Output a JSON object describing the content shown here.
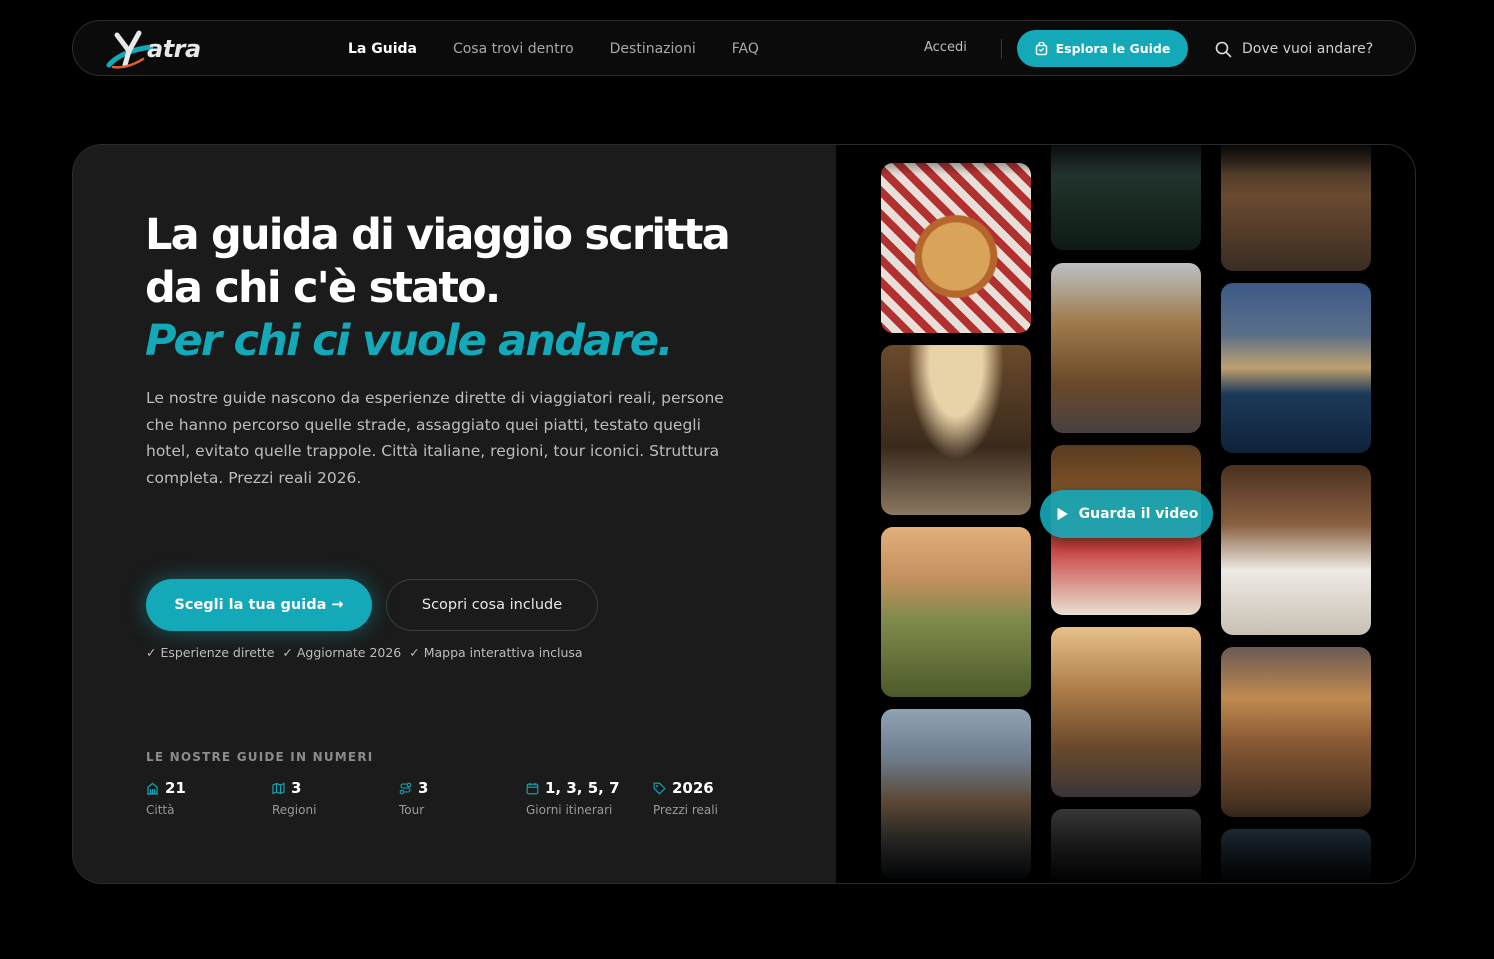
{
  "brand": {
    "logo_text": "atra"
  },
  "nav": {
    "links": [
      "La Guida",
      "Cosa trovi dentro",
      "Destinazioni",
      "FAQ"
    ],
    "login": "Accedi",
    "cta": "Esplora le Guide",
    "search_placeholder": "Dove vuoi andare?"
  },
  "hero": {
    "headline_line1": "La guida di viaggio scritta",
    "headline_line2": "da chi c'è stato.",
    "headline_accent": "Per chi ci vuole andare.",
    "description": "Le nostre guide nascono da esperienze dirette di viaggiatori reali, persone che hanno percorso quelle strade, assaggiato quei piatti, testato quegli hotel, evitato quelle trappole. Città italiane, regioni, tour iconici. Struttura completa. Prezzi reali 2026.",
    "cta_primary": "Scegli la tua guida →",
    "cta_secondary": "Scopri cosa include",
    "checks": [
      "✓ Esperienze dirette",
      "✓ Aggiornate 2026",
      "✓ Mappa interattiva inclusa"
    ],
    "stats_title": "LE NOSTRE GUIDE IN NUMERI",
    "stats": [
      {
        "value": "21",
        "label": "Città",
        "icon": "building-icon"
      },
      {
        "value": "3",
        "label": "Regioni",
        "icon": "map-icon"
      },
      {
        "value": "3",
        "label": "Tour",
        "icon": "route-icon"
      },
      {
        "value": "1, 3, 5, 7",
        "label": "Giorni itinerari",
        "icon": "calendar-icon"
      },
      {
        "value": "2026",
        "label": "Prezzi reali",
        "icon": "tag-icon"
      }
    ],
    "video_button": "Guarda il video"
  },
  "colors": {
    "accent": "#14a9b8",
    "panel": "#1b1b1b",
    "background": "#000000"
  }
}
